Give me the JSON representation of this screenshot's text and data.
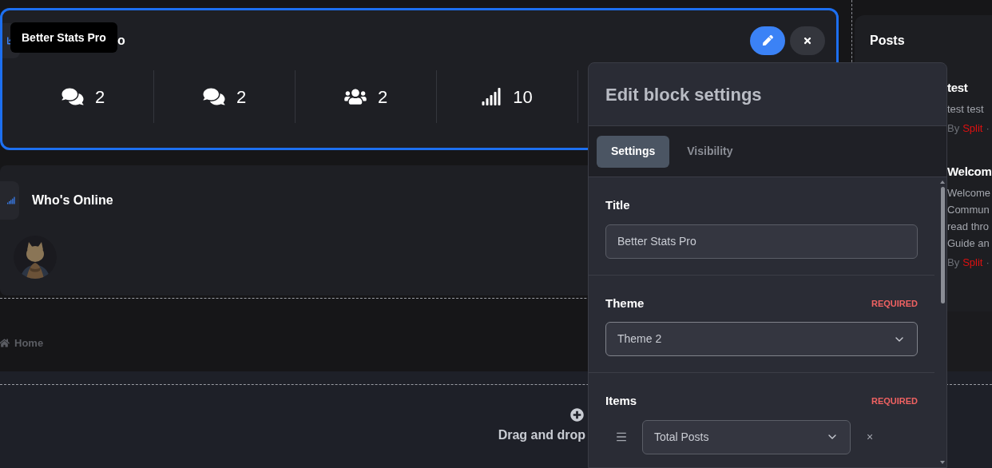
{
  "stats_block": {
    "tooltip": "Better Stats Pro",
    "title": "o",
    "stats": [
      {
        "kind": "comments",
        "value": "2"
      },
      {
        "kind": "comments",
        "value": "2"
      },
      {
        "kind": "users",
        "value": "2"
      },
      {
        "kind": "signal",
        "value": "10"
      }
    ]
  },
  "whos_online": {
    "title": "Who's Online"
  },
  "breadcrumb": {
    "label": "Home"
  },
  "drop_zone": {
    "label": "Drag and drop"
  },
  "posts": {
    "title": "Posts",
    "items": [
      {
        "title": "test",
        "lines": [
          "test test"
        ],
        "by": "By",
        "author": "Split",
        "separator": "·"
      },
      {
        "title": "Welcom",
        "lines": [
          "Welcome",
          "Commun",
          "read thro",
          "Guide an"
        ],
        "by": "By",
        "author": "Split",
        "separator": "·"
      }
    ]
  },
  "popover": {
    "title": "Edit block settings",
    "tabs": [
      {
        "label": "Settings",
        "selected": true
      },
      {
        "label": "Visibility",
        "selected": false
      }
    ],
    "fields": [
      {
        "kind": "input",
        "label": "Title",
        "value": "Better Stats Pro"
      },
      {
        "kind": "select",
        "label": "Theme",
        "required": "REQUIRED",
        "value": "Theme 2"
      },
      {
        "kind": "list",
        "label": "Items",
        "required": "REQUIRED",
        "rows": [
          {
            "value": "Total Posts",
            "remove": "×"
          }
        ]
      }
    ]
  }
}
